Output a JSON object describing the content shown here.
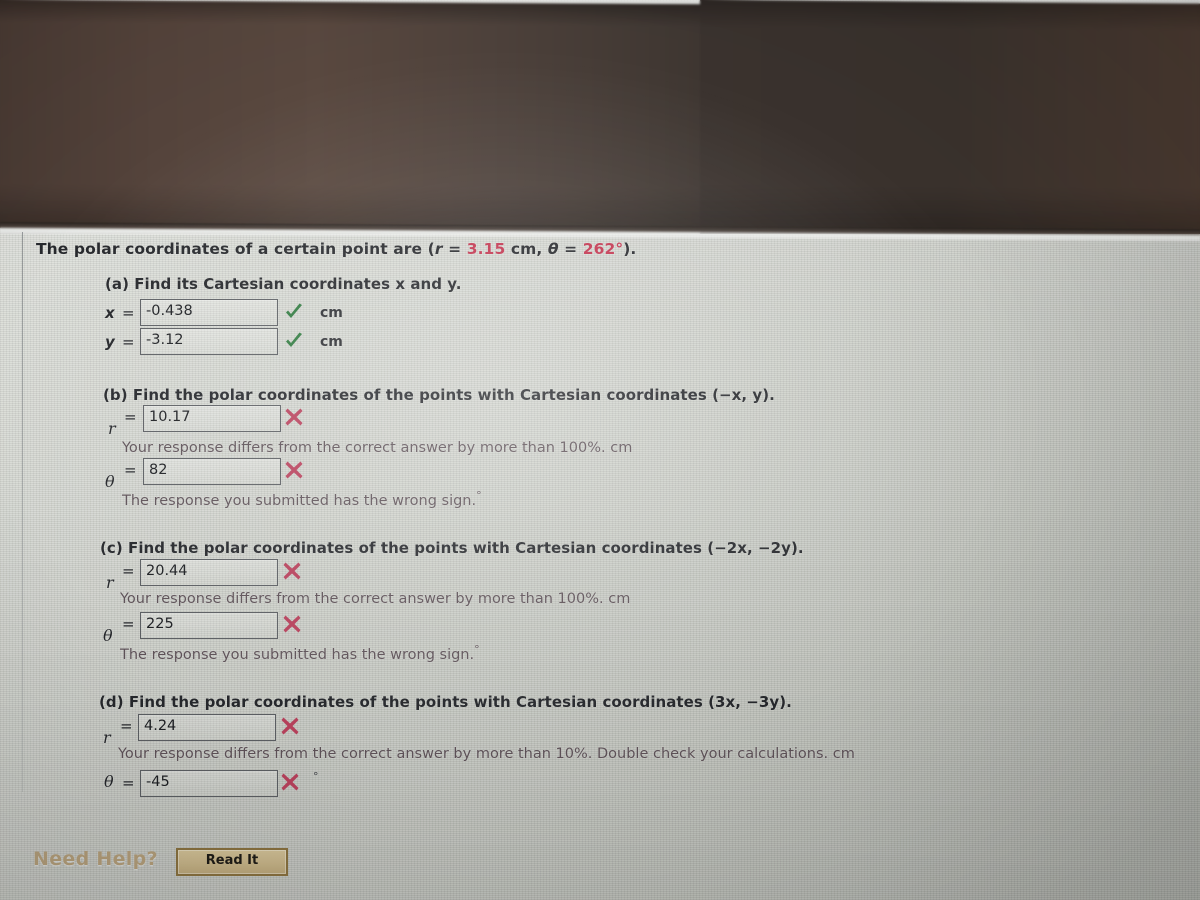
{
  "question": {
    "prompt_prefix": "The polar coordinates of a certain point are (",
    "r_symbol": "r",
    "r_eq": " = ",
    "r_value": "3.15",
    "r_unit": " cm, ",
    "theta_symbol": "θ",
    "theta_eq": " = ",
    "theta_value": "262°",
    "prompt_suffix": ")."
  },
  "parts": [
    {
      "id": "a",
      "heading": "(a) Find its Cartesian coordinates x and y.",
      "rows": [
        {
          "label": "x",
          "equals": "=",
          "value": "-0.438",
          "status": "correct",
          "status_icon": "check-icon",
          "unit": "cm",
          "feedback": ""
        },
        {
          "label": "y",
          "equals": "=",
          "value": "-3.12",
          "status": "correct",
          "status_icon": "check-icon",
          "unit": "cm",
          "feedback": ""
        }
      ]
    },
    {
      "id": "b",
      "heading": "(b) Find the polar coordinates of the points with Cartesian coordinates (−x, y).",
      "rows": [
        {
          "label": "r",
          "equals": "=",
          "value": "10.17",
          "status": "incorrect",
          "status_icon": "cross-icon",
          "unit": "cm",
          "feedback": "Your response differs from the correct answer by more than 100%."
        },
        {
          "label": "θ",
          "equals": "=",
          "value": "82",
          "status": "incorrect",
          "status_icon": "cross-icon",
          "unit": "°",
          "feedback": "The response you submitted has the wrong sign."
        }
      ]
    },
    {
      "id": "c",
      "heading": "(c) Find the polar coordinates of the points with Cartesian coordinates (−2x, −2y).",
      "rows": [
        {
          "label": "r",
          "equals": "=",
          "value": "20.44",
          "status": "incorrect",
          "status_icon": "cross-icon",
          "unit": "cm",
          "feedback": "Your response differs from the correct answer by more than 100%."
        },
        {
          "label": "θ",
          "equals": "=",
          "value": "225",
          "status": "incorrect",
          "status_icon": "cross-icon",
          "unit": "°",
          "feedback": "The response you submitted has the wrong sign."
        }
      ]
    },
    {
      "id": "d",
      "heading": "(d) Find the polar coordinates of the points with Cartesian coordinates (3x, −3y).",
      "rows": [
        {
          "label": "r",
          "equals": "=",
          "value": "4.24",
          "status": "incorrect",
          "status_icon": "cross-icon",
          "unit": "cm",
          "feedback": "Your response differs from the correct answer by more than 10%. Double check your calculations."
        },
        {
          "label": "θ",
          "equals": "=",
          "value": "-45",
          "status": "incorrect",
          "status_icon": "cross-icon",
          "unit": "°",
          "feedback": ""
        }
      ]
    }
  ],
  "help": {
    "label": "Need Help?",
    "button_label": "Read It"
  },
  "colors": {
    "accent_red": "#c2354f",
    "correct_green": "#2f7a3f",
    "incorrect_red": "#b8415c",
    "help_label": "#b5a07c",
    "button_bg": "#c9b68a",
    "button_border": "#8a7240",
    "text": "#26282c",
    "feedback": "#5e5258",
    "page_bg": "#cfd2cb",
    "shadow_band": "#4e423c"
  }
}
